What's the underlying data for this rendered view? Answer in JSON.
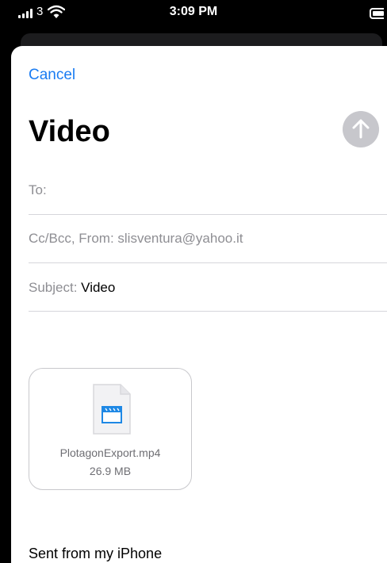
{
  "status_bar": {
    "carrier": "3",
    "time": "3:09 PM"
  },
  "compose": {
    "cancel_label": "Cancel",
    "title": "Video",
    "to_label": "To:",
    "cc_label": "Cc/Bcc, From:",
    "from_value": "slisventura@yahoo.it",
    "subject_label": "Subject:",
    "subject_value": "Video",
    "attachment": {
      "name": "PlotagonExport.mp4",
      "size": "26.9 MB",
      "icon": "video-file-icon"
    },
    "signature": "Sent from my iPhone"
  },
  "colors": {
    "accent": "#1a7cf2",
    "send_disabled": "#c7c7cc",
    "secondary_text": "#8e8e93"
  }
}
